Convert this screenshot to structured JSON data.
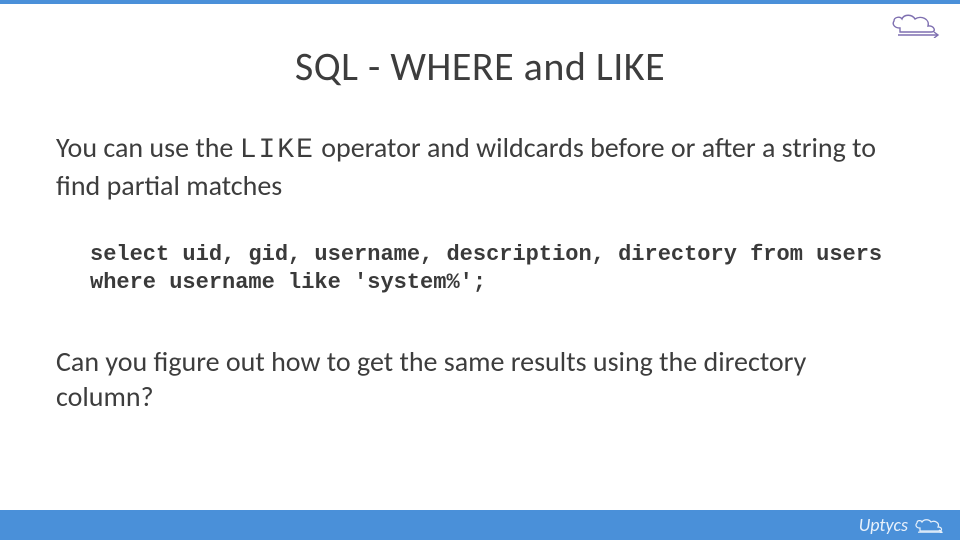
{
  "title": "SQL - WHERE and LIKE",
  "intro": {
    "pre": "You can use the ",
    "op": "LIKE",
    "post": " operator and wildcards before or after a string to find partial matches"
  },
  "code": "select uid, gid, username, description, directory from users where username like 'system%';",
  "question": "Can you figure out how to get the same results using the directory column?",
  "brand": "Uptycs",
  "colors": {
    "accent": "#4a90d9",
    "cloud": "#7e6fb0"
  }
}
